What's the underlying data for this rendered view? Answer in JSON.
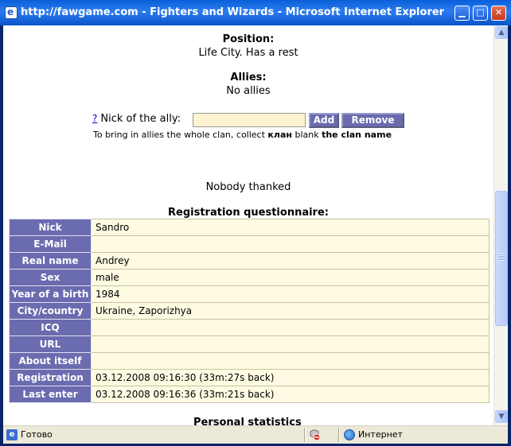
{
  "window": {
    "title": "http://fawgame.com - Fighters and Wizards - Microsoft Internet Explorer",
    "buttons": {
      "minimize": "▁",
      "maximize": "□",
      "close": "✕"
    }
  },
  "page": {
    "position": {
      "heading": "Position:",
      "value": "Life City. Has a rest"
    },
    "allies": {
      "heading": "Allies:",
      "value": "No allies"
    },
    "ally_form": {
      "help_link": "?",
      "label": "Nick of the ally:",
      "input_value": "",
      "add_label": "Add",
      "remove_label": "Remove",
      "hint_prefix": "To bring in allies the whole clan, collect",
      "hint_keyword": "клан",
      "hint_middle": "blank",
      "hint_suffix": "the clan name"
    },
    "thanks": "Nobody thanked",
    "questionnaire": {
      "heading": "Registration questionnaire:",
      "rows": [
        {
          "label": "Nick",
          "value": "Sandro"
        },
        {
          "label": "E-Mail",
          "value": ""
        },
        {
          "label": "Real name",
          "value": "Andrey"
        },
        {
          "label": "Sex",
          "value": "male"
        },
        {
          "label": "Year of a birth",
          "value": "1984"
        },
        {
          "label": "City/country",
          "value": "Ukraine, Zaporizhya"
        },
        {
          "label": "ICQ",
          "value": ""
        },
        {
          "label": "URL",
          "value": ""
        },
        {
          "label": "About itself",
          "value": ""
        },
        {
          "label": "Registration",
          "value": "03.12.2008 09:16:30 (33m:27s back)"
        },
        {
          "label": "Last enter",
          "value": "03.12.2008 09:16:36 (33m:21s back)"
        }
      ]
    },
    "clipped_heading": "Personal statistics"
  },
  "statusbar": {
    "left_text": "Готово",
    "zone_text": "Интернет",
    "icons": [
      "ie-page-icon",
      "privacy-report-icon",
      "internet-zone-globe-icon"
    ]
  },
  "scrollbar": {
    "up": "▲",
    "down": "▼"
  }
}
